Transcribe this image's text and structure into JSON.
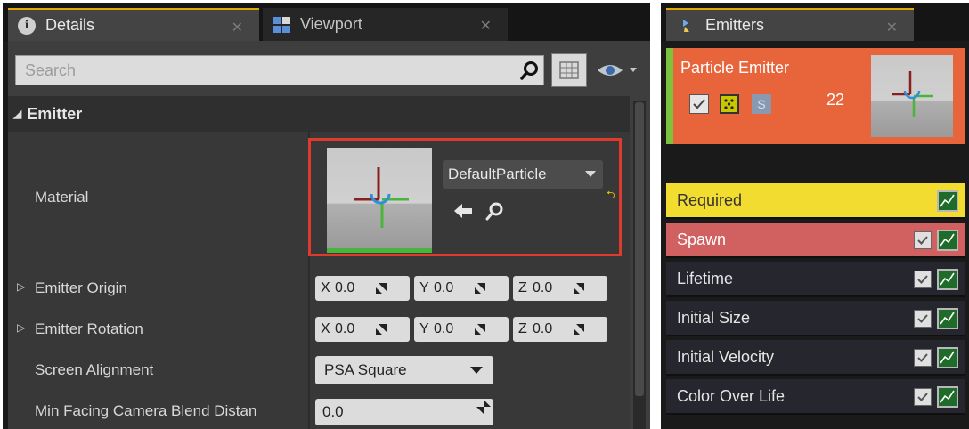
{
  "details_panel": {
    "tabs": [
      {
        "label": "Details",
        "icon": "info-icon",
        "active": true
      },
      {
        "label": "Viewport",
        "icon": "viewport-icon",
        "active": false
      }
    ],
    "search": {
      "placeholder": "Search",
      "value": ""
    },
    "category": {
      "label": "Emitter"
    },
    "material": {
      "label": "Material",
      "asset": "DefaultParticle"
    },
    "emitter_origin": {
      "label": "Emitter Origin",
      "x_label": "X",
      "x": "0.0",
      "y_label": "Y",
      "y": "0.0",
      "z_label": "Z",
      "z": "0.0"
    },
    "emitter_rotation": {
      "label": "Emitter Rotation",
      "x_label": "X",
      "x": "0.0",
      "y_label": "Y",
      "y": "0.0",
      "z_label": "Z",
      "z": "0.0"
    },
    "screen_alignment": {
      "label": "Screen Alignment",
      "value": "PSA Square"
    },
    "min_facing": {
      "label": "Min Facing Camera Blend Distan",
      "value": "0.0"
    },
    "highlight_color": "#e03a2e"
  },
  "emitters_panel": {
    "tab": {
      "label": "Emitters",
      "icon": "emitter-icon"
    },
    "emitter": {
      "name": "Particle Emitter",
      "count": "22",
      "solo_label": "S",
      "color": "#e8643a"
    },
    "modules": [
      {
        "label": "Required",
        "bg": "#f2dc30",
        "fg": "#333333",
        "has_checkbox": false
      },
      {
        "label": "Spawn",
        "bg": "#d16060",
        "fg": "#ffffff",
        "has_checkbox": true
      },
      {
        "label": "Lifetime",
        "bg": "#26262e",
        "fg": "#e6e6e6",
        "has_checkbox": true
      },
      {
        "label": "Initial Size",
        "bg": "#26262e",
        "fg": "#e6e6e6",
        "has_checkbox": true
      },
      {
        "label": "Initial Velocity",
        "bg": "#26262e",
        "fg": "#e6e6e6",
        "has_checkbox": true
      },
      {
        "label": "Color Over Life",
        "bg": "#26262e",
        "fg": "#e6e6e6",
        "has_checkbox": true
      }
    ]
  }
}
